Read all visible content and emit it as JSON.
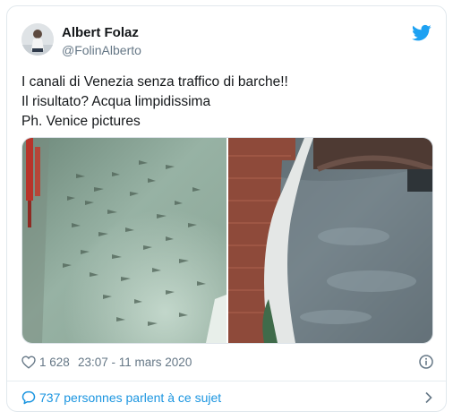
{
  "tweet": {
    "author_name": "Albert Folaz",
    "author_handle": "@FolinAlberto",
    "text_lines": [
      "I canali di Venezia senza traffico di barche!!",
      "Il risultato? Acqua limpidissima",
      "Ph. Venice pictures"
    ],
    "likes": "1 628",
    "timestamp": "23:07 - 11 mars 2020",
    "conversation_link": "737 personnes parlent à ce sujet"
  },
  "icons": {
    "brand": "twitter-bird-icon",
    "like": "heart-icon",
    "info": "info-icon",
    "reply": "speech-bubble-icon",
    "chevron": "chevron-right-icon"
  },
  "colors": {
    "brand_blue": "#1da1f2",
    "link_blue": "#1b95e0",
    "secondary_text": "#657786",
    "primary_text": "#14171a"
  }
}
